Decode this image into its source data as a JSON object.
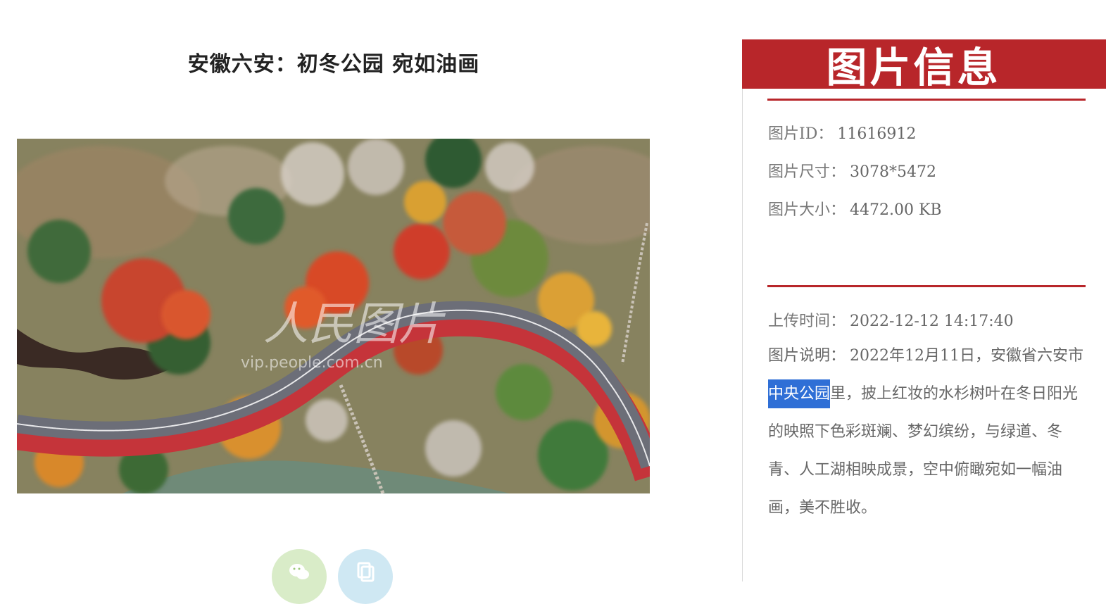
{
  "article": {
    "title": "安徽六安：初冬公园 宛如油画",
    "watermark_text": "人民图片",
    "watermark_url": "vip.people.com.cn"
  },
  "share": {
    "wechat_icon": "wechat-icon",
    "copy_icon": "copy-icon"
  },
  "info_panel": {
    "header": "图片信息",
    "accent_color": "#b8262a",
    "id_label": "图片ID：",
    "id_value": "11616912",
    "dims_label": "图片尺寸：",
    "dims_value": "3078*5472",
    "size_label": "图片大小：",
    "size_value": "4472.00 KB",
    "upload_label": "上传时间：",
    "upload_value": "2022-12-12 14:17:40",
    "desc_label": "图片说明：",
    "desc_before": "2022年12月11日，安徽省六安市",
    "desc_highlight": "中央公园",
    "desc_after": "里，披上红妆的水杉树叶在冬日阳光的映照下色彩斑斓、梦幻缤纷，与绿道、冬青、人工湖相映成景，空中俯瞰宛如一幅油画，美不胜收。",
    "highlight_color": "#2f6fd6"
  }
}
